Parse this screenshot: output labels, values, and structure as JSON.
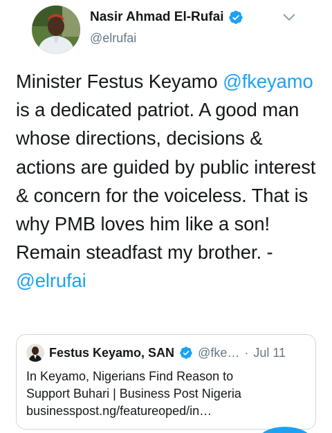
{
  "author": {
    "display_name": "Nasir Ahmad El-Rufai",
    "handle": "@elrufai",
    "verified_icon": "verified-badge-icon",
    "avatar_icon": "avatar-photo",
    "menu_icon": "chevron-down-icon"
  },
  "tweet": {
    "text_1": "Minister Festus Keyamo ",
    "mention_1": "@fkeyamo",
    "text_2": " is a dedicated patriot. A good man whose directions, decisions & actions are guided by public interest & concern for the voiceless. That is why PMB loves him like a son! Remain steadfast my brother. - ",
    "mention_2": "@elrufai"
  },
  "quoted_tweet": {
    "display_name": "Festus Keyamo, SAN",
    "handle": "@fke…",
    "separator": "·",
    "date": "Jul 11",
    "line_1": "In Keyamo, Nigerians Find Reason to",
    "line_2": "Support Buhari | Business Post Nigeria",
    "line_3": "businesspost.ng/featureoped/in…"
  },
  "colors": {
    "accent": "#1da1f2",
    "text": "#14171a",
    "secondary_text": "#657786",
    "border": "#ccd6dd"
  }
}
